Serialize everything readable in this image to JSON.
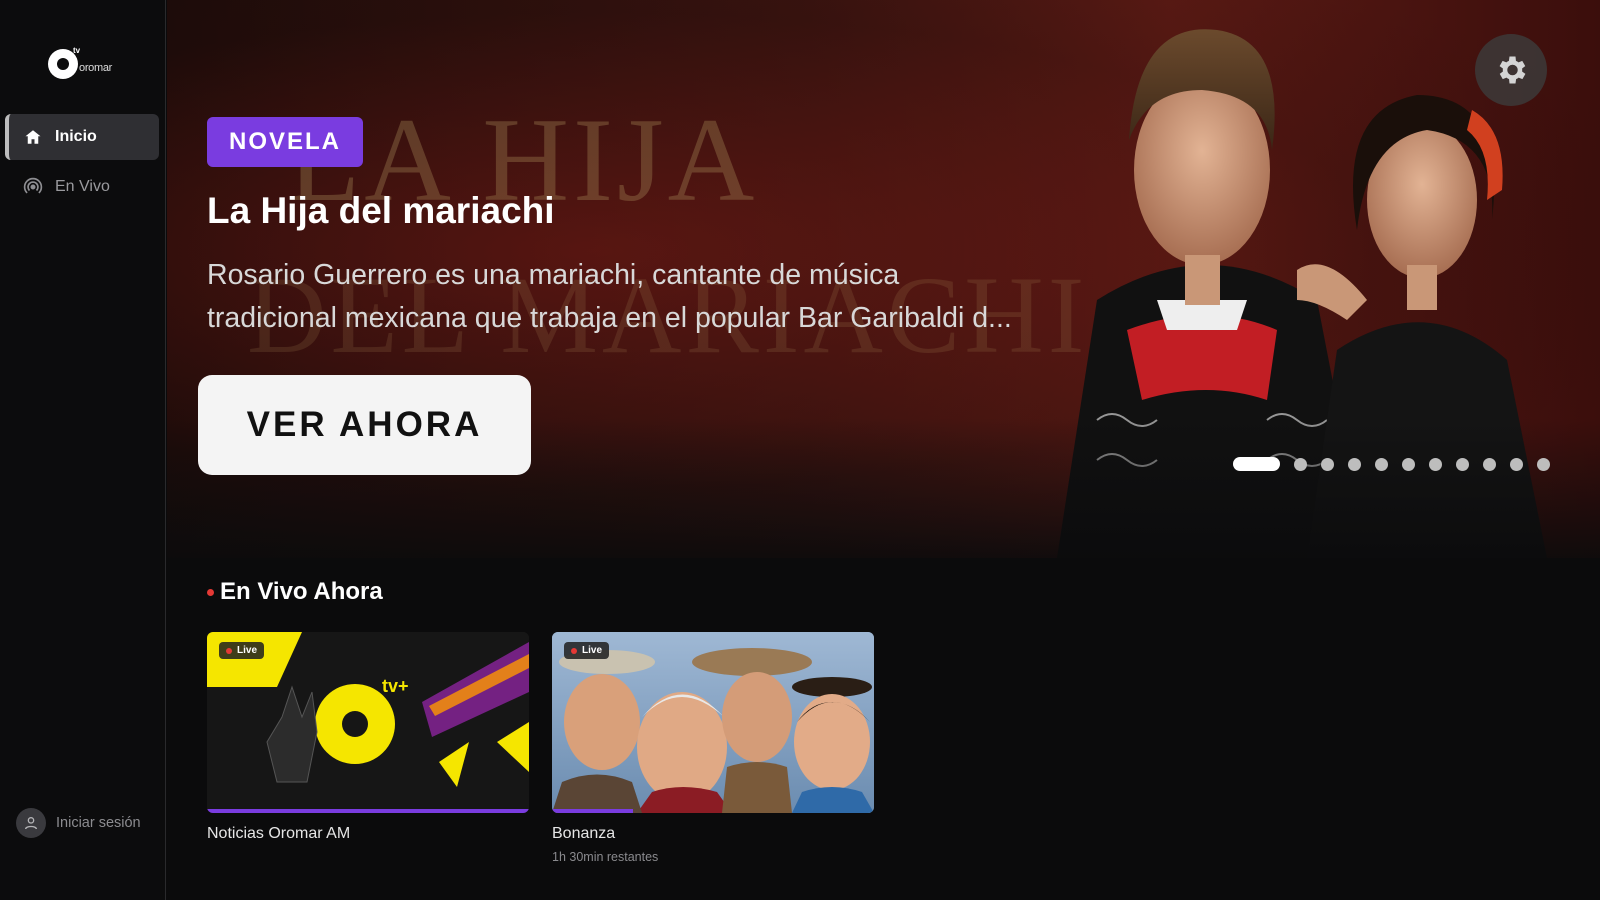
{
  "app": {
    "logo_text": "oromar",
    "logo_superscript": "tv"
  },
  "sidebar": {
    "items": [
      {
        "label": "Inicio",
        "icon": "home-icon",
        "active": true
      },
      {
        "label": "En Vivo",
        "icon": "broadcast-icon",
        "active": false
      }
    ],
    "login_label": "Iniciar sesión"
  },
  "hero": {
    "badge": "NOVELA",
    "title": "La Hija del mariachi",
    "description_line1": "Rosario Guerrero es una mariachi, cantante de música",
    "description_line2": "tradicional mexicana que trabaja en el popular Bar Garibaldi d...",
    "background_title_line1": "LA HIJA",
    "background_title_line2": "DEL MARIACHI",
    "watch_button": "VER AHORA",
    "carousel": {
      "total": 11,
      "active_index": 0
    },
    "settings_icon": "gear-icon"
  },
  "live_section": {
    "title": "En Vivo Ahora",
    "cards": [
      {
        "live_label": "Live",
        "name": "Noticias Oromar AM",
        "subtitle": "",
        "progress": 1.0
      },
      {
        "live_label": "Live",
        "name": "Bonanza",
        "subtitle": "1h 30min restantes",
        "progress": 0.25
      }
    ]
  },
  "colors": {
    "accent": "#7a3ce0",
    "live": "#e53935",
    "background": "#0b0b0c"
  }
}
